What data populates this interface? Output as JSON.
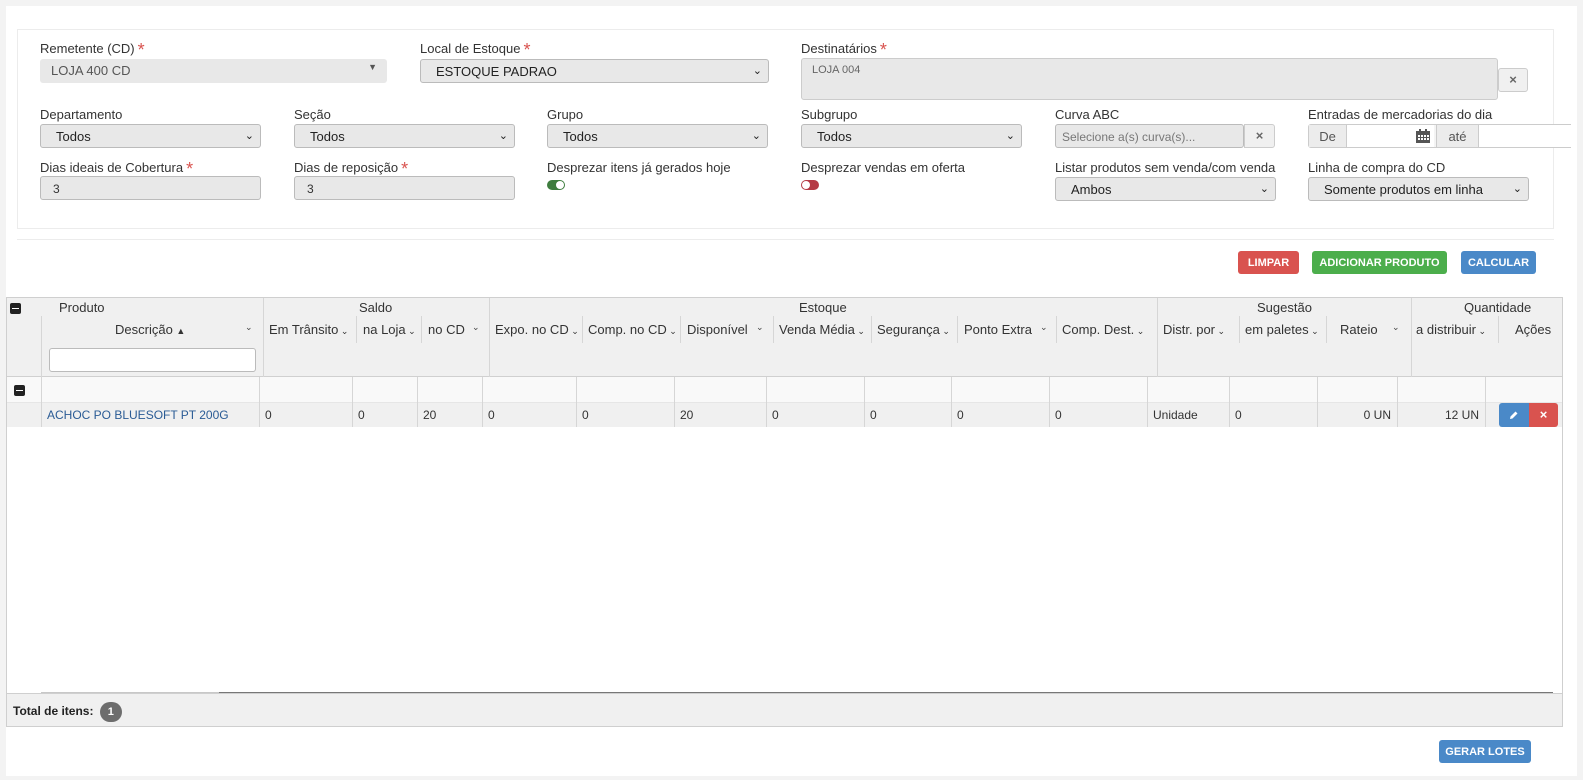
{
  "filters": {
    "remetente": {
      "label": "Remetente (CD)",
      "value": "LOJA 400 CD"
    },
    "local_estoque": {
      "label": "Local de Estoque",
      "value": "ESTOQUE PADRAO"
    },
    "destinatarios": {
      "label": "Destinatários",
      "tag": "LOJA 004",
      "clear": "×"
    },
    "departamento": {
      "label": "Departamento",
      "value": "Todos"
    },
    "secao": {
      "label": "Seção",
      "value": "Todos"
    },
    "grupo": {
      "label": "Grupo",
      "value": "Todos"
    },
    "subgrupo": {
      "label": "Subgrupo",
      "value": "Todos"
    },
    "curva_abc": {
      "label": "Curva ABC",
      "placeholder": "Selecione a(s) curva(s)...",
      "clear": "×"
    },
    "entradas": {
      "label": "Entradas de mercadorias do dia",
      "de": "De",
      "ate": "até"
    },
    "dias_cobertura": {
      "label": "Dias ideais de Cobertura",
      "value": "3"
    },
    "dias_reposicao": {
      "label": "Dias de reposição",
      "value": "3"
    },
    "desprezar_itens": {
      "label": "Desprezar itens já gerados hoje",
      "on": true
    },
    "desprezar_vendas": {
      "label": "Desprezar vendas em oferta",
      "on": false
    },
    "listar_produtos": {
      "label": "Listar produtos sem venda/com venda",
      "value": "Ambos"
    },
    "linha_compra": {
      "label": "Linha de compra do CD",
      "value": "Somente produtos em linha"
    }
  },
  "required_mark": "*",
  "actions": {
    "limpar": "LIMPAR",
    "adicionar": "ADICIONAR PRODUTO",
    "calcular": "CALCULAR",
    "gerar_lotes": "GERAR LOTES"
  },
  "grid": {
    "groups": {
      "produto": "Produto",
      "saldo": "Saldo",
      "estoque": "Estoque",
      "sugestao": "Sugestão",
      "quantidade": "Quantidade"
    },
    "columns": {
      "descricao": "Descrição",
      "em_transito": "Em Trânsito",
      "na_loja": "na Loja",
      "no_cd": "no CD",
      "expo_cd": "Expo. no CD",
      "comp_cd": "Comp. no CD",
      "disponivel": "Disponível",
      "venda_media": "Venda Média",
      "seguranca": "Segurança",
      "ponto_extra": "Ponto Extra",
      "comp_dest": "Comp. Dest.",
      "distr_por": "Distr. por",
      "em_paletes": "em paletes",
      "rateio": "Rateio",
      "a_distribuir": "a distribuir",
      "acoes": "Ações"
    },
    "rows": [
      {
        "descricao": "ACHOC PO BLUESOFT PT 200G",
        "em_transito": "0",
        "na_loja": "0",
        "no_cd": "20",
        "expo_cd": "0",
        "comp_cd": "0",
        "disponivel": "20",
        "venda_media": "0",
        "seguranca": "0",
        "ponto_extra": "0",
        "comp_dest": "0",
        "distr_por": "Unidade",
        "em_paletes": "0",
        "rateio": "0 UN",
        "a_distribuir": "12 UN"
      }
    ],
    "footer": {
      "label": "Total de itens:",
      "count": "1"
    }
  },
  "colors": {
    "danger": "#d9534f",
    "success": "#4cae4c",
    "primary": "#4a89c8",
    "link": "#2a5b95"
  }
}
